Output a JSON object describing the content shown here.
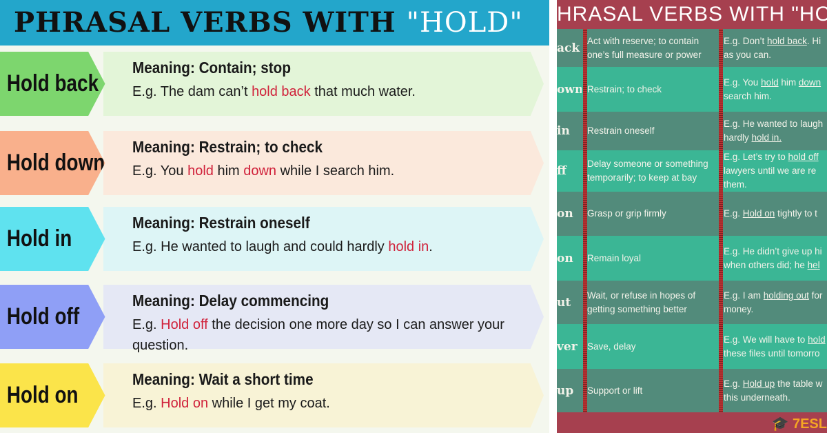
{
  "left": {
    "title_prefix": "PHRASAL VERBS WITH ",
    "title_highlight": "\"HOLD\"",
    "rows": [
      {
        "verb": "Hold back",
        "meaning": "Meaning: Contain; stop",
        "tag_color": "#7dd66e",
        "band_color": "#e3f5d8",
        "example": [
          {
            "t": "E.g. The dam can’t "
          },
          {
            "t": "hold back",
            "hl": true
          },
          {
            "t": " that much water."
          }
        ]
      },
      {
        "verb": "Hold down",
        "meaning": "Meaning: Restrain; to check",
        "tag_color": "#f9b08c",
        "band_color": "#fbe9dc",
        "example": [
          {
            "t": "E.g. You "
          },
          {
            "t": "hold",
            "hl": true
          },
          {
            "t": " him "
          },
          {
            "t": "down",
            "hl": true
          },
          {
            "t": " while I search him."
          }
        ]
      },
      {
        "verb": "Hold in",
        "meaning": "Meaning: Restrain oneself",
        "tag_color": "#5fe2ef",
        "band_color": "#ddf5f6",
        "example": [
          {
            "t": "E.g. He wanted to laugh and could hardly "
          },
          {
            "t": "hold in",
            "hl": true
          },
          {
            "t": "."
          }
        ]
      },
      {
        "verb": "Hold off",
        "meaning": "Meaning: Delay commencing",
        "tag_color": "#8f9ff6",
        "band_color": "#e5e8f5",
        "example": [
          {
            "t": "E.g. "
          },
          {
            "t": "Hold off",
            "hl": true
          },
          {
            "t": " the decision one more day so I can answer your question."
          }
        ]
      },
      {
        "verb": "Hold on",
        "meaning": "Meaning: Wait a short time",
        "tag_color": "#fbe44a",
        "band_color": "#f8f3d6",
        "example": [
          {
            "t": "E.g. "
          },
          {
            "t": "Hold on",
            "hl": true
          },
          {
            "t": " while I get my coat."
          }
        ]
      }
    ]
  },
  "right": {
    "title": "HRASAL VERBS WITH \"HOL",
    "rows": [
      {
        "verb": "ack",
        "meaning": "Act with reserve; to contain one’s full measure or power",
        "example": [
          {
            "t": "E.g. Don’t "
          },
          {
            "t": "hold back",
            "u": true
          },
          {
            "t": ". Hi"
          },
          {
            "br": true
          },
          {
            "t": "as you can."
          }
        ]
      },
      {
        "verb": "own",
        "meaning": "Restrain; to check",
        "example": [
          {
            "t": "E.g. You "
          },
          {
            "t": "hold",
            "u": true
          },
          {
            "t": " him "
          },
          {
            "t": "down",
            "u": true
          },
          {
            "br": true
          },
          {
            "t": "search him."
          }
        ]
      },
      {
        "verb": "in",
        "meaning": "Restrain oneself",
        "example": [
          {
            "t": "E.g. He wanted to laugh"
          },
          {
            "br": true
          },
          {
            "t": "hardly "
          },
          {
            "t": "hold in.",
            "u": true
          }
        ]
      },
      {
        "verb": "ff",
        "meaning": "Delay someone or something temporarily; to keep at bay",
        "example": [
          {
            "t": "E.g. Let’s try to "
          },
          {
            "t": "hold off",
            "u": true
          },
          {
            "br": true
          },
          {
            "t": "lawyers until we are re"
          },
          {
            "br": true
          },
          {
            "t": "them."
          }
        ]
      },
      {
        "verb": "on",
        "meaning": "Grasp or grip firmly",
        "example": [
          {
            "t": "E.g. "
          },
          {
            "t": "Hold on",
            "u": true
          },
          {
            "t": " tightly to t"
          }
        ]
      },
      {
        "verb": "on",
        "meaning": "Remain loyal",
        "example": [
          {
            "t": "E.g. He didn’t give up hi"
          },
          {
            "br": true
          },
          {
            "t": "when others did; he "
          },
          {
            "t": "hel",
            "u": true
          }
        ]
      },
      {
        "verb": "ut",
        "meaning": "Wait, or refuse in hopes of getting something better",
        "example": [
          {
            "t": "E.g. I am "
          },
          {
            "t": "holding out",
            "u": true
          },
          {
            "t": " for"
          },
          {
            "br": true
          },
          {
            "t": "money."
          }
        ]
      },
      {
        "verb": "ver",
        "meaning": "Save, delay",
        "example": [
          {
            "t": "E.g. We will have to "
          },
          {
            "t": "hold",
            "u": true
          },
          {
            "br": true
          },
          {
            "t": "these files until tomorro"
          }
        ]
      },
      {
        "verb": "up",
        "meaning": "Support or lift",
        "example": [
          {
            "t": "E.g. "
          },
          {
            "t": "Hold up",
            "u": true
          },
          {
            "t": " the table w"
          },
          {
            "br": true
          },
          {
            "t": "this underneath."
          }
        ]
      }
    ],
    "logo_text": "7ESL",
    "colors": {
      "header": "#a6404f",
      "row_dark": "#528b7b",
      "row_light": "#3bb695",
      "logo": "#f5a623"
    }
  }
}
